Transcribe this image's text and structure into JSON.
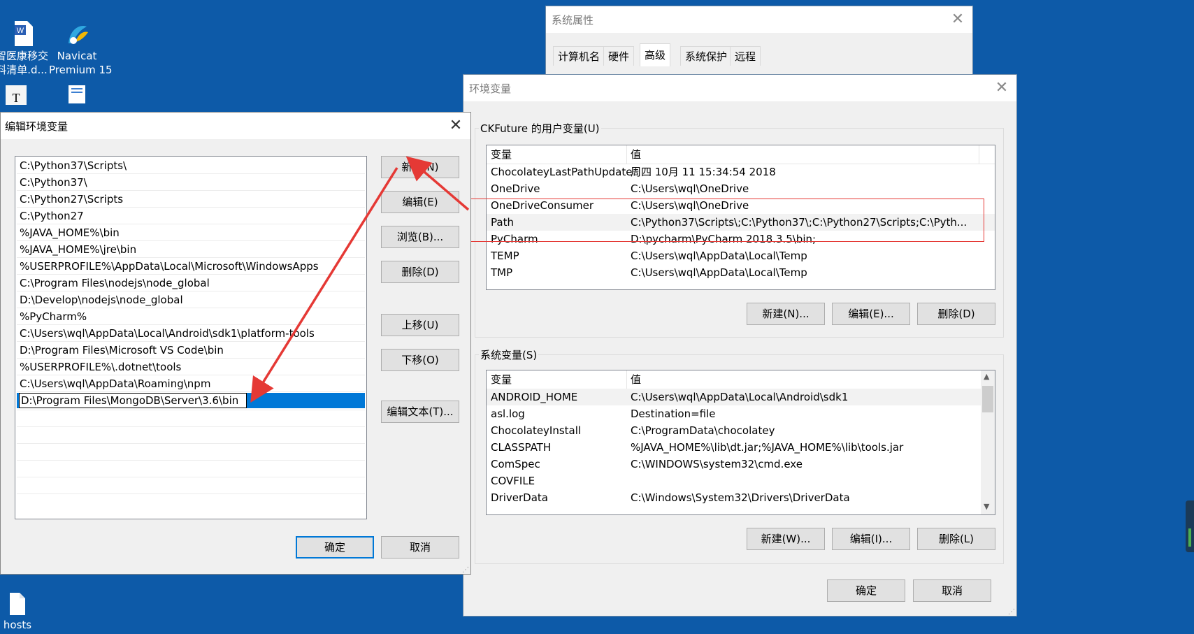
{
  "desktop": {
    "icons": [
      {
        "label": "智医康移交\n料清单.d...",
        "icon": "word-document-icon"
      },
      {
        "label": "Navicat\nPremium 15",
        "icon": "navicat-icon"
      },
      {
        "label": "hosts",
        "icon": "file-icon"
      }
    ]
  },
  "system_properties": {
    "title": "系统属性",
    "tabs": [
      "计算机名",
      "硬件",
      "高级",
      "系统保护",
      "远程"
    ],
    "active_tab": "高级"
  },
  "env_vars": {
    "title": "环境变量",
    "user_group_label": "CKFuture 的用户变量(U)",
    "columns": [
      "变量",
      "值"
    ],
    "user_vars": [
      {
        "name": "ChocolateyLastPathUpdate",
        "value": "周四 10月 11 15:34:54 2018"
      },
      {
        "name": "OneDrive",
        "value": "C:\\Users\\wql\\OneDrive"
      },
      {
        "name": "OneDriveConsumer",
        "value": "C:\\Users\\wql\\OneDrive"
      },
      {
        "name": "Path",
        "value": "C:\\Python37\\Scripts\\;C:\\Python37\\;C:\\Python27\\Scripts;C:\\Pyth..."
      },
      {
        "name": "PyCharm",
        "value": "D:\\pycharm\\PyCharm 2018.3.5\\bin;"
      },
      {
        "name": "TEMP",
        "value": "C:\\Users\\wql\\AppData\\Local\\Temp"
      },
      {
        "name": "TMP",
        "value": "C:\\Users\\wql\\AppData\\Local\\Temp"
      }
    ],
    "user_buttons": {
      "new": "新建(N)...",
      "edit": "编辑(E)...",
      "delete": "删除(D)"
    },
    "system_group_label": "系统变量(S)",
    "system_vars": [
      {
        "name": "ANDROID_HOME",
        "value": "C:\\Users\\wql\\AppData\\Local\\Android\\sdk1"
      },
      {
        "name": "asl.log",
        "value": "Destination=file"
      },
      {
        "name": "ChocolateyInstall",
        "value": "C:\\ProgramData\\chocolatey"
      },
      {
        "name": "CLASSPATH",
        "value": "%JAVA_HOME%\\lib\\dt.jar;%JAVA_HOME%\\lib\\tools.jar"
      },
      {
        "name": "ComSpec",
        "value": "C:\\WINDOWS\\system32\\cmd.exe"
      },
      {
        "name": "COVFILE",
        "value": ""
      },
      {
        "name": "DriverData",
        "value": "C:\\Windows\\System32\\Drivers\\DriverData"
      }
    ],
    "system_buttons": {
      "new": "新建(W)...",
      "edit": "编辑(I)...",
      "delete": "删除(L)"
    },
    "ok": "确定",
    "cancel": "取消"
  },
  "edit_env": {
    "title": "编辑环境变量",
    "entries": [
      "C:\\Python37\\Scripts\\",
      "C:\\Python37\\",
      "C:\\Python27\\Scripts",
      "C:\\Python27",
      "%JAVA_HOME%\\bin",
      "%JAVA_HOME%\\jre\\bin",
      "%USERPROFILE%\\AppData\\Local\\Microsoft\\WindowsApps",
      "C:\\Program Files\\nodejs\\node_global",
      "D:\\Develop\\nodejs\\node_global",
      "%PyCharm%",
      "C:\\Users\\wql\\AppData\\Local\\Android\\sdk1\\platform-tools",
      "D:\\Program Files\\Microsoft VS Code\\bin",
      "%USERPROFILE%\\.dotnet\\tools",
      "C:\\Users\\wql\\AppData\\Roaming\\npm"
    ],
    "editing_value": "D:\\Program Files\\MongoDB\\Server\\3.6\\bin",
    "buttons": {
      "new": "新建(N)",
      "edit": "编辑(E)",
      "browse": "浏览(B)...",
      "delete": "删除(D)",
      "move_up": "上移(U)",
      "move_down": "下移(O)",
      "edit_text": "编辑文本(T)..."
    },
    "ok": "确定",
    "cancel": "取消"
  },
  "colors": {
    "desktop": "#0d5aa8",
    "selection": "#0078d7",
    "annotation": "#e53935"
  }
}
